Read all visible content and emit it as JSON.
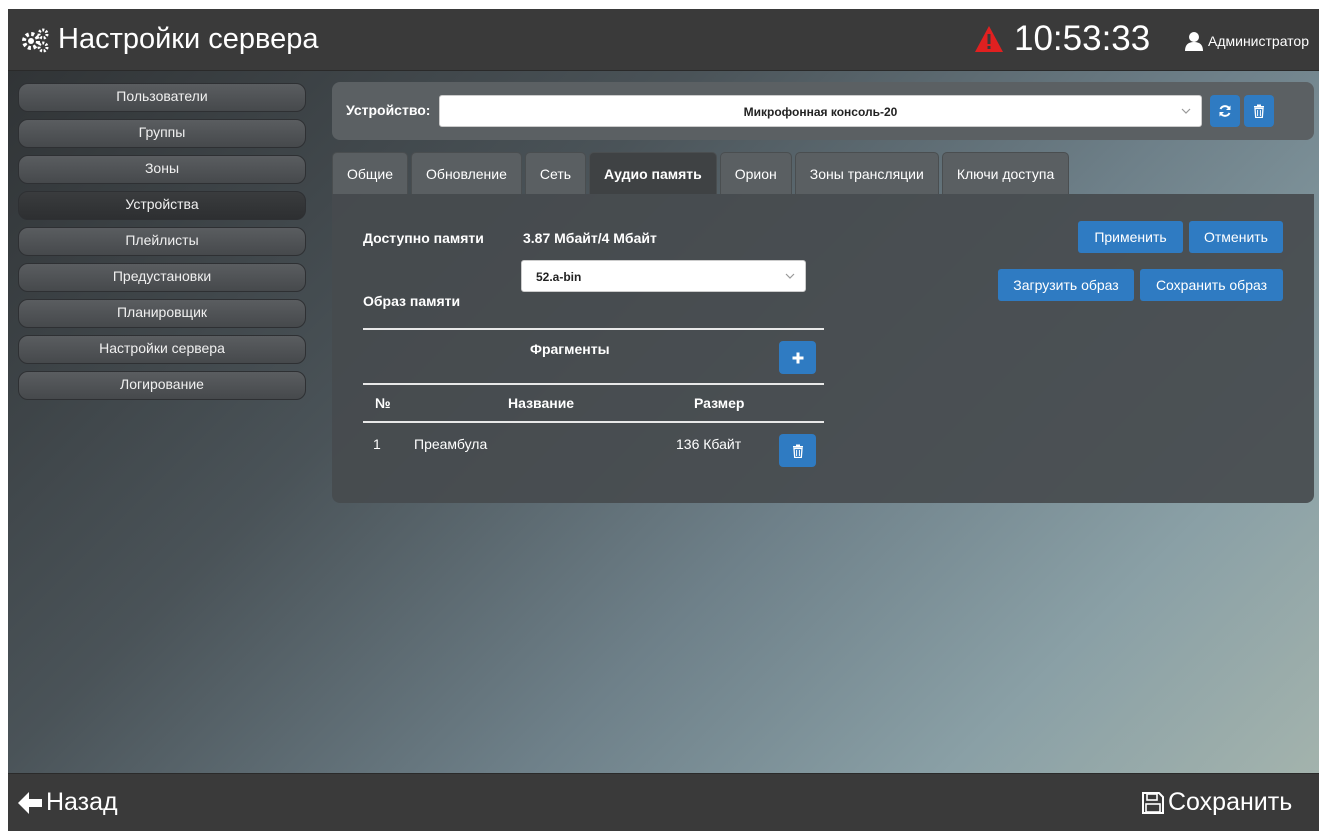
{
  "header": {
    "title": "Настройки сервера",
    "time": "10:53:33",
    "user": "Администратор",
    "alert_color": "#e02020"
  },
  "sidebar": {
    "items": [
      {
        "label": "Пользователи"
      },
      {
        "label": "Группы"
      },
      {
        "label": "Зоны"
      },
      {
        "label": "Устройства",
        "active": true
      },
      {
        "label": "Плейлисты"
      },
      {
        "label": "Предустановки"
      },
      {
        "label": "Планировщик"
      },
      {
        "label": "Настройки сервера"
      },
      {
        "label": "Логирование"
      }
    ]
  },
  "device": {
    "label": "Устройство:",
    "selected": "Микрофонная консоль-20"
  },
  "tabs": [
    {
      "label": "Общие"
    },
    {
      "label": "Обновление"
    },
    {
      "label": "Сеть"
    },
    {
      "label": "Аудио память",
      "active": true
    },
    {
      "label": "Орион"
    },
    {
      "label": "Зоны трансляции"
    },
    {
      "label": "Ключи доступа"
    }
  ],
  "audio_memory": {
    "available_label": "Доступно памяти",
    "available_value": "3.87 Мбайт/4 Мбайт",
    "image_label": "Образ памяти",
    "image_value": "52.a-bin",
    "apply_label": "Применить",
    "cancel_label": "Отменить",
    "load_label": "Загрузить образ",
    "save_image_label": "Сохранить образ",
    "fragments": {
      "title": "Фрагменты",
      "columns": [
        "№",
        "Название",
        "Размер"
      ],
      "rows": [
        {
          "num": "1",
          "name": "Преамбула",
          "size": "136 Кбайт"
        }
      ]
    }
  },
  "footer": {
    "back_label": "Назад",
    "save_label": "Сохранить"
  },
  "colors": {
    "accent": "#2f7bc2",
    "bar": "#3a3a3a"
  }
}
